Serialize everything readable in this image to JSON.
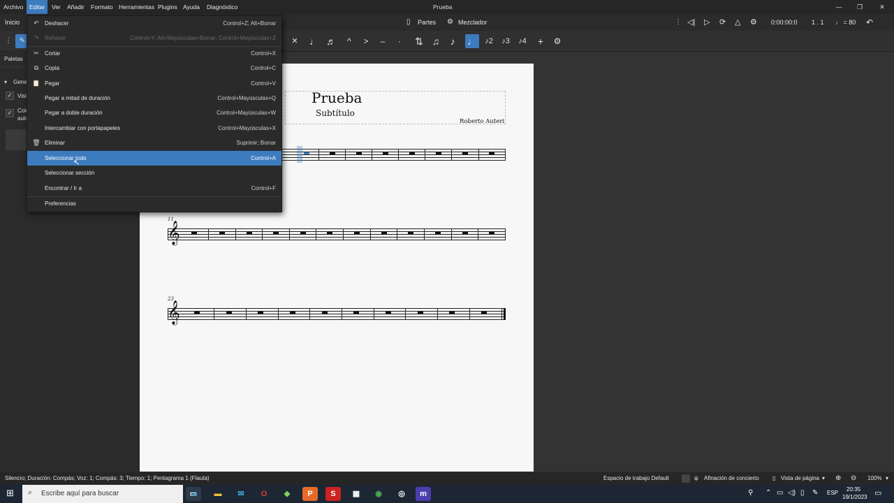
{
  "app_title": "Prueba",
  "menubar": [
    "Archivo",
    "Editar",
    "Ver",
    "Añadir",
    "Formato",
    "Herramientas",
    "Plugins",
    "Ayuda",
    "Diagnóstico"
  ],
  "tabs": {
    "home": "Inicio",
    "parts": "Partes",
    "mixer": "Mezclador"
  },
  "playback": {
    "time": "0:00:00:0",
    "position": "1 . 1",
    "tempo": "♩ = 80"
  },
  "palettes": {
    "title": "Paletas",
    "group": "Gene",
    "option1": "Visi",
    "option2": "Colo",
    "option2b": "auto"
  },
  "edit_menu": {
    "items": [
      {
        "label": "Deshacer",
        "shortcut": "Control+Z; Alt+Borrar",
        "icon": "↶",
        "disabled": false
      },
      {
        "label": "Rehacer",
        "shortcut": "Control+Y; Alt+Mayúsculas+Borrar; Control+Mayúsculas+Z",
        "icon": "↷",
        "disabled": true
      },
      {
        "label": "Cortar",
        "shortcut": "Control+X",
        "icon": "✂",
        "disabled": false
      },
      {
        "label": "Copia",
        "shortcut": "Control+C",
        "icon": "⧉",
        "disabled": false
      },
      {
        "label": "Pegar",
        "shortcut": "Control+V",
        "icon": "📋",
        "disabled": false
      },
      {
        "label": "Pegar a mitad de duración",
        "shortcut": "Control+Mayúsculas+Q",
        "icon": "",
        "disabled": false
      },
      {
        "label": "Pegar a doble duración",
        "shortcut": "Control+Mayúsculas+W",
        "icon": "",
        "disabled": false
      },
      {
        "label": "Intercambiar con portapapeles",
        "shortcut": "Control+Mayúsculas+X",
        "icon": "",
        "disabled": false
      },
      {
        "label": "Eliminar",
        "shortcut": "Suprimir; Borrar",
        "icon": "🗑",
        "disabled": false
      },
      {
        "label": "Seleccionar todo",
        "shortcut": "Control+A",
        "icon": "",
        "disabled": false
      },
      {
        "label": "Seleccionar sección",
        "shortcut": "",
        "icon": "",
        "disabled": false
      },
      {
        "label": "Encontrar / Ir a",
        "shortcut": "Control+F",
        "icon": "",
        "disabled": false
      },
      {
        "label": "Preferencias",
        "shortcut": "",
        "icon": "",
        "disabled": false
      }
    ]
  },
  "score": {
    "title": "Prueba",
    "subtitle": "Subtítulo",
    "composer": "Roberto Auteri",
    "measure_numbers": [
      "11",
      "23"
    ]
  },
  "statusbar": {
    "left": "Silencio; Duración: Compás; Voz: 1; Compás: 3; Tiempo: 1; Pentagrama 1 (Flauta)",
    "workspace": "Espacio de trabajo Default",
    "concert": "Afinación de concierto",
    "view": "Vista de página",
    "zoom": "100%"
  },
  "taskbar": {
    "search_placeholder": "Escribe aquí para buscar",
    "lang": "ESP",
    "time": "20:35",
    "date": "19/1/2023"
  },
  "colors": {
    "accent": "#3d7bbf",
    "menu_bg": "#2a2a2a",
    "page": "#f7f7f7"
  }
}
